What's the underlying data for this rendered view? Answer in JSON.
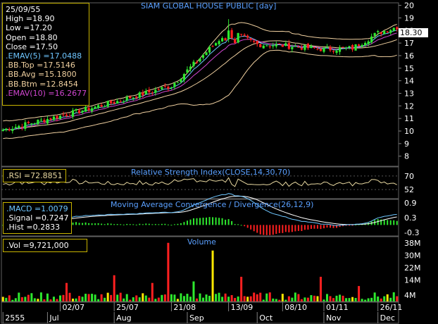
{
  "colors": {
    "up": "#2ee82e",
    "down": "#ff2020",
    "bb": "#f0d0a0",
    "emav5": "#6ec6ff",
    "emav10": "#d046d0",
    "rsi": "#e8d8a0",
    "macd": "#6ec6ff",
    "signal": "#ffffff",
    "hist_pos": "#2ee82e",
    "hist_neg": "#ff2020",
    "vol_up": "#2ee82e",
    "vol_down": "#ff2020",
    "vol_flat": "#ffe800",
    "grid": "#808080",
    "axis_text": "#ffffff",
    "title": "#5aa0ff"
  },
  "main": {
    "title": "SIAM GLOBAL HOUSE PUBLIC [day]",
    "last_price": "18.30",
    "info": {
      "date": "25/09/55",
      "high": "High  =18.90",
      "low": "Low  =17.20",
      "open": "Open  =18.80",
      "close": "Close  =17.50",
      "emav5": ".EMAV(5)  =17.0488",
      "bbtop": ".BB.Top  =17.5146",
      "bbavg": ".BB.Avg  =15.1800",
      "bbbtm": ".BB.Btm  =12.8454",
      "emav10": ".EMAV(10)  =16.2677"
    }
  },
  "rsi": {
    "title": "Relative Strength Index(CLOSE,14,30,70)",
    "value": ".RSI  =72.8851"
  },
  "macd": {
    "title": "Moving Average Convergence / Divergence(26,12,9)",
    "macd": ".MACD  =1.0079",
    "signal": ".Signal  =0.7247",
    "hist": ".Hist  =0.2833"
  },
  "volume": {
    "title": "Volume",
    "value": ".Vol  =9,721,000"
  },
  "x_axis": {
    "date_ticks": [
      "02/07",
      "25/07",
      "21/08",
      "13/09",
      "08/10",
      "01/11",
      "26/11"
    ],
    "month_labels": [
      "2555",
      "Jul",
      "Aug",
      "Sep",
      "Oct",
      "Nov",
      "Dec"
    ]
  },
  "chart_data": {
    "type": "candlestick",
    "title": "SIAM GLOBAL HOUSE PUBLIC [day]",
    "price_axis": {
      "ylim": [
        7.2,
        20.2
      ],
      "ticks": [
        8,
        9,
        10,
        11,
        12,
        13,
        14,
        15,
        16,
        17,
        18,
        19,
        20
      ]
    },
    "close_anchors": {
      "x": [
        "start",
        "02/07",
        "25/07",
        "21/08",
        "13/09 spike",
        "mid-Sep",
        "08/10",
        "01/11",
        "mid-Nov",
        "26/11",
        "end"
      ],
      "close": [
        10.1,
        11.2,
        12.3,
        13.6,
        18.0,
        16.9,
        16.8,
        16.5,
        16.6,
        17.8,
        18.3
      ]
    },
    "spike_high": 18.9,
    "rsi_axis": {
      "ticks": [
        52,
        70
      ]
    },
    "macd_axis": {
      "ticks": [
        -0.3,
        0.3,
        0.9
      ]
    },
    "volume_axis": {
      "unit": "M",
      "ticks": [
        "4M",
        "14M",
        "22M",
        "30M",
        "38M"
      ]
    },
    "volume_peaks_M": [
      {
        "at": "Aug",
        "value": 38
      },
      {
        "at": "Aug",
        "value": 33
      },
      {
        "at": "Jul",
        "value": 17
      },
      {
        "at": "Nov",
        "value": 16
      },
      {
        "at": "Sep",
        "value": 16
      }
    ]
  }
}
